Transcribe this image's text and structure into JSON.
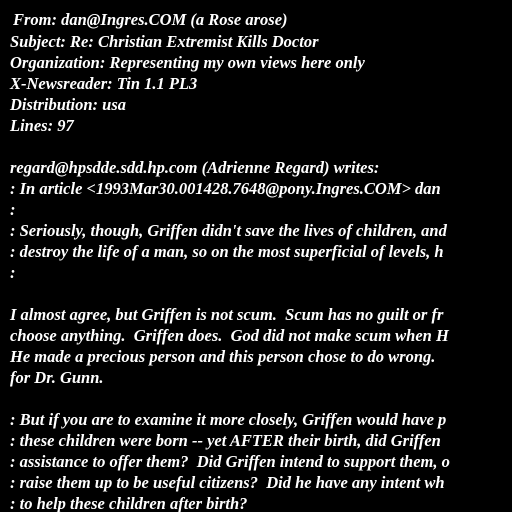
{
  "email": {
    "header": {
      "from": "From: dan@Ingres.COM (a Rose arose)",
      "subject": "Subject: Re: Christian Extremist Kills Doctor",
      "organization": "Organization: Representing my own views here only",
      "newsreader": "X-Newsreader: Tin 1.1 PL3",
      "distribution": "Distribution: usa",
      "lines": "Lines: 97"
    },
    "body": [
      "regard@hpsdde.sdd.hp.com (Adrienne Regard) writes:",
      ": In article <1993Mar30.001428.7648@pony.Ingres.COM> dan",
      ":",
      ": Seriously, though, Griffen didn't save the lives of children, and",
      ": destroy the life of a man, so on the most superficial of levels, h",
      ":",
      "",
      "I almost agree, but Griffen is not scum.  Scum has no guilt or fr",
      "choose anything.  Griffen does.  God did not make scum when H",
      "He made a precious person and this person chose to do wrong.",
      "for Dr. Gunn.",
      "",
      ": But if you are to examine it more closely, Griffen would have p",
      ": these children were born -- yet AFTER their birth, did Griffen",
      ": assistance to offer them?  Did Griffen intend to support them, o",
      ": raise them up to be useful citizens?  Did he have any intent wh",
      ": to help these children after birth?"
    ]
  }
}
